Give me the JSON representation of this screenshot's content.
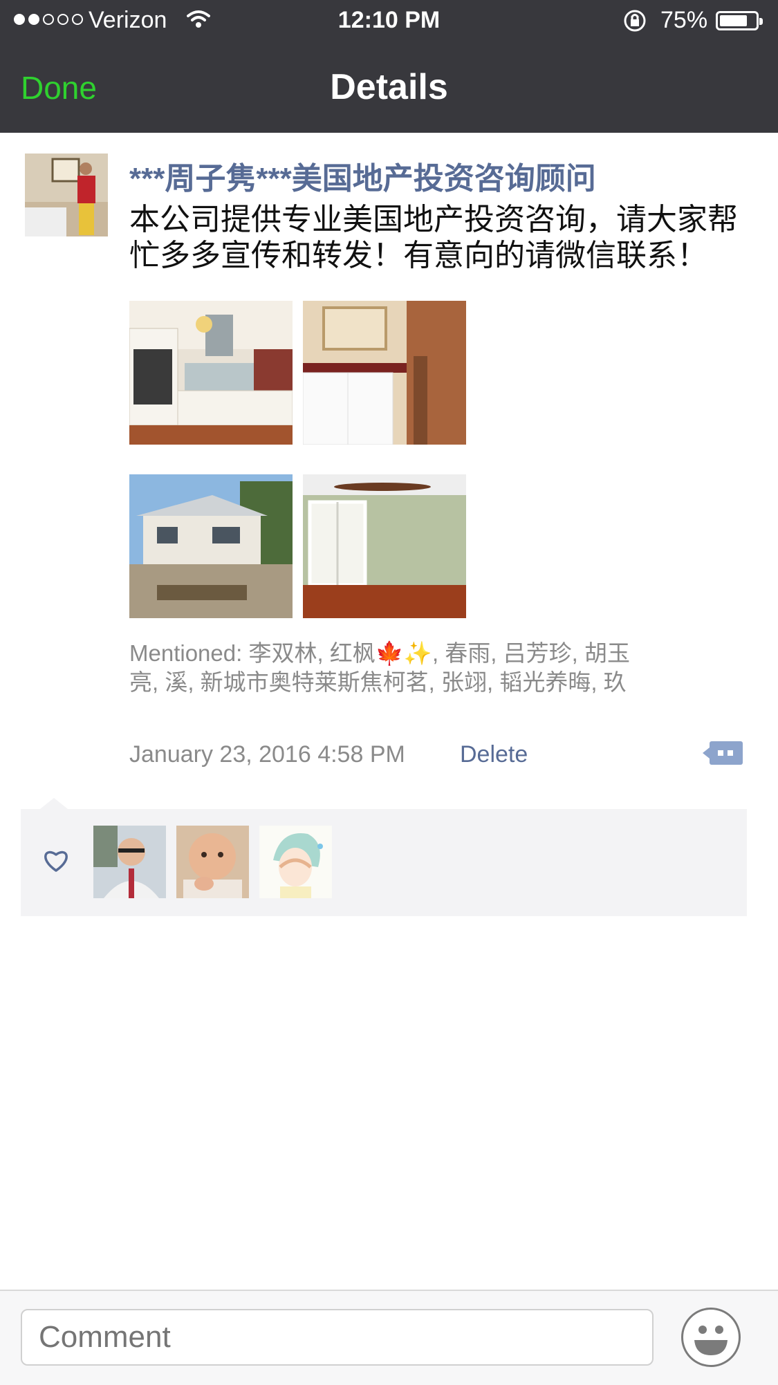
{
  "status_bar": {
    "carrier": "Verizon",
    "time": "12:10 PM",
    "battery_percent": "75%",
    "signal_filled": 2,
    "signal_total": 5,
    "battery_level": 0.75
  },
  "nav": {
    "done_label": "Done",
    "title": "Details",
    "done_color": "#2fd12f"
  },
  "post": {
    "author": "***周子隽***美国地产投资咨询顾问",
    "text": "本公司提供专业美国地产投资咨询，请大家帮忙多多宣传和转发！有意向的请微信联系！",
    "photos": [
      "kitchen-photo",
      "bathroom-photo",
      "house-exterior-photo",
      "bedroom-photo"
    ],
    "mentioned": "Mentioned: 李双林, 红枫🍁✨, 春雨, 吕芳珍, 胡玉亮, 溪, 新城市奥特莱斯焦柯茗, 张翊, 韬光养晦, 玖",
    "timestamp": "January 23, 2016 4:58 PM",
    "delete_label": "Delete",
    "link_color": "#576b95"
  },
  "likes": {
    "icon": "heart-icon",
    "avatars": [
      "man-in-suit-avatar",
      "baby-avatar",
      "anime-character-avatar"
    ]
  },
  "comment_bar": {
    "placeholder": "Comment",
    "emoji_icon": "smiley-face-icon"
  }
}
